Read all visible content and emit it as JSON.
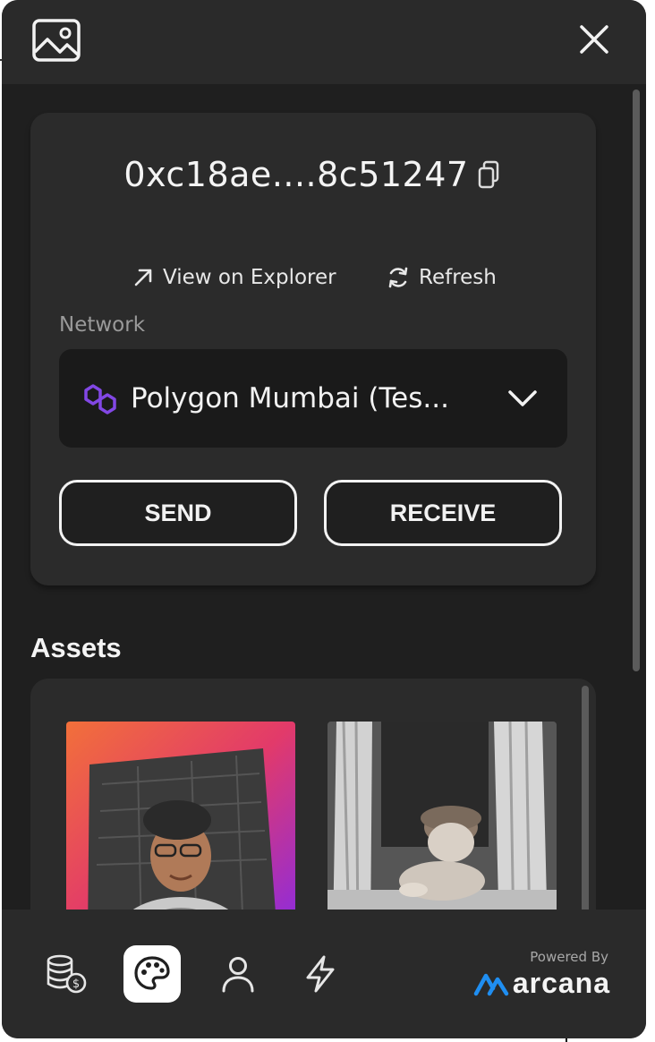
{
  "header": {
    "gallery_icon": "image-gallery-icon",
    "close_icon": "close-icon"
  },
  "wallet": {
    "address": "0xc18ae....8c51247",
    "copy_icon": "copy-icon",
    "view_explorer_label": "View on Explorer",
    "refresh_label": "Refresh"
  },
  "network": {
    "label": "Network",
    "selected": "Polygon Mumbai (Tes...",
    "icon": "polygon-icon"
  },
  "actions": {
    "send_label": "SEND",
    "receive_label": "RECEIVE"
  },
  "assets": {
    "title": "Assets",
    "items": [
      {
        "kind": "nft-image",
        "desc": "avatar-nft-icon"
      },
      {
        "kind": "nft-image",
        "desc": "baby-photo-nft-icon"
      }
    ]
  },
  "footer": {
    "nav": [
      {
        "name": "tokens",
        "icon": "coins-icon"
      },
      {
        "name": "nfts",
        "icon": "palette-icon",
        "active": true
      },
      {
        "name": "profile",
        "icon": "user-icon"
      },
      {
        "name": "activity",
        "icon": "lightning-icon"
      }
    ],
    "powered_by": "Powered By",
    "brand": "arcana"
  },
  "colors": {
    "background": "#1f1f1f",
    "card": "#2b2b2b",
    "text": "#f2f2f2",
    "muted": "#9a9a9a",
    "polygon": "#8247e5",
    "arcana_blue": "#1f8ef1"
  }
}
